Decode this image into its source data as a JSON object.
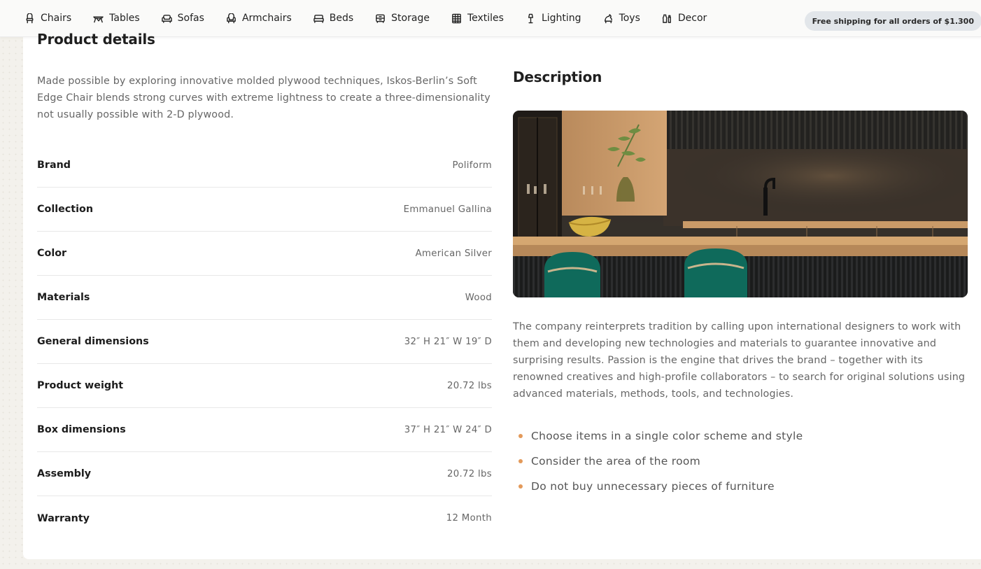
{
  "nav": {
    "items": [
      {
        "label": "Chairs",
        "icon": "chair-icon"
      },
      {
        "label": "Tables",
        "icon": "table-icon"
      },
      {
        "label": "Sofas",
        "icon": "sofa-icon"
      },
      {
        "label": "Armchairs",
        "icon": "armchair-icon"
      },
      {
        "label": "Beds",
        "icon": "bed-icon"
      },
      {
        "label": "Storage",
        "icon": "storage-icon"
      },
      {
        "label": "Textiles",
        "icon": "textile-icon"
      },
      {
        "label": "Lighting",
        "icon": "lamp-icon"
      },
      {
        "label": "Toys",
        "icon": "toy-icon"
      },
      {
        "label": "Decor",
        "icon": "vase-icon"
      }
    ],
    "shipping_badge": "Free shipping for all orders of $1.300"
  },
  "details": {
    "title": "Product details",
    "intro": "Made possible by exploring innovative molded plywood techniques, Iskos-Berlin’s Soft Edge Chair blends strong curves with extreme lightness to create a three-dimensionality not usually possible with 2-D plywood.",
    "specs": [
      {
        "label": "Brand",
        "value": "Poliform"
      },
      {
        "label": "Collection",
        "value": "Emmanuel Gallina"
      },
      {
        "label": "Color",
        "value": "American Silver"
      },
      {
        "label": "Materials",
        "value": "Wood"
      },
      {
        "label": "General dimensions",
        "value": "32″ H 21″ W 19″ D"
      },
      {
        "label": "Product weight",
        "value": "20.72 lbs"
      },
      {
        "label": "Box dimensions",
        "value": "37″ H 21″ W 24″ D"
      },
      {
        "label": "Assembly",
        "value": "20.72 lbs"
      },
      {
        "label": "Warranty",
        "value": "12 Month"
      }
    ]
  },
  "description": {
    "title": "Description",
    "image_icon": "kitchen-photo",
    "text": "The company reinterprets tradition by calling upon international designers to work with them and developing new technologies and materials to guarantee innovative and surprising results. Passion is the engine that drives the brand – together with its renowned creatives and high-profile collaborators – to search for original solutions using advanced materials, methods, tools, and technologies.",
    "tips": [
      "Choose items in a single color scheme and style",
      "Consider the area of the room",
      "Do not buy unnecessary pieces of furniture"
    ]
  },
  "colors": {
    "accent_dot": "#e39a5a",
    "badge_bg": "#e2e6ea"
  }
}
